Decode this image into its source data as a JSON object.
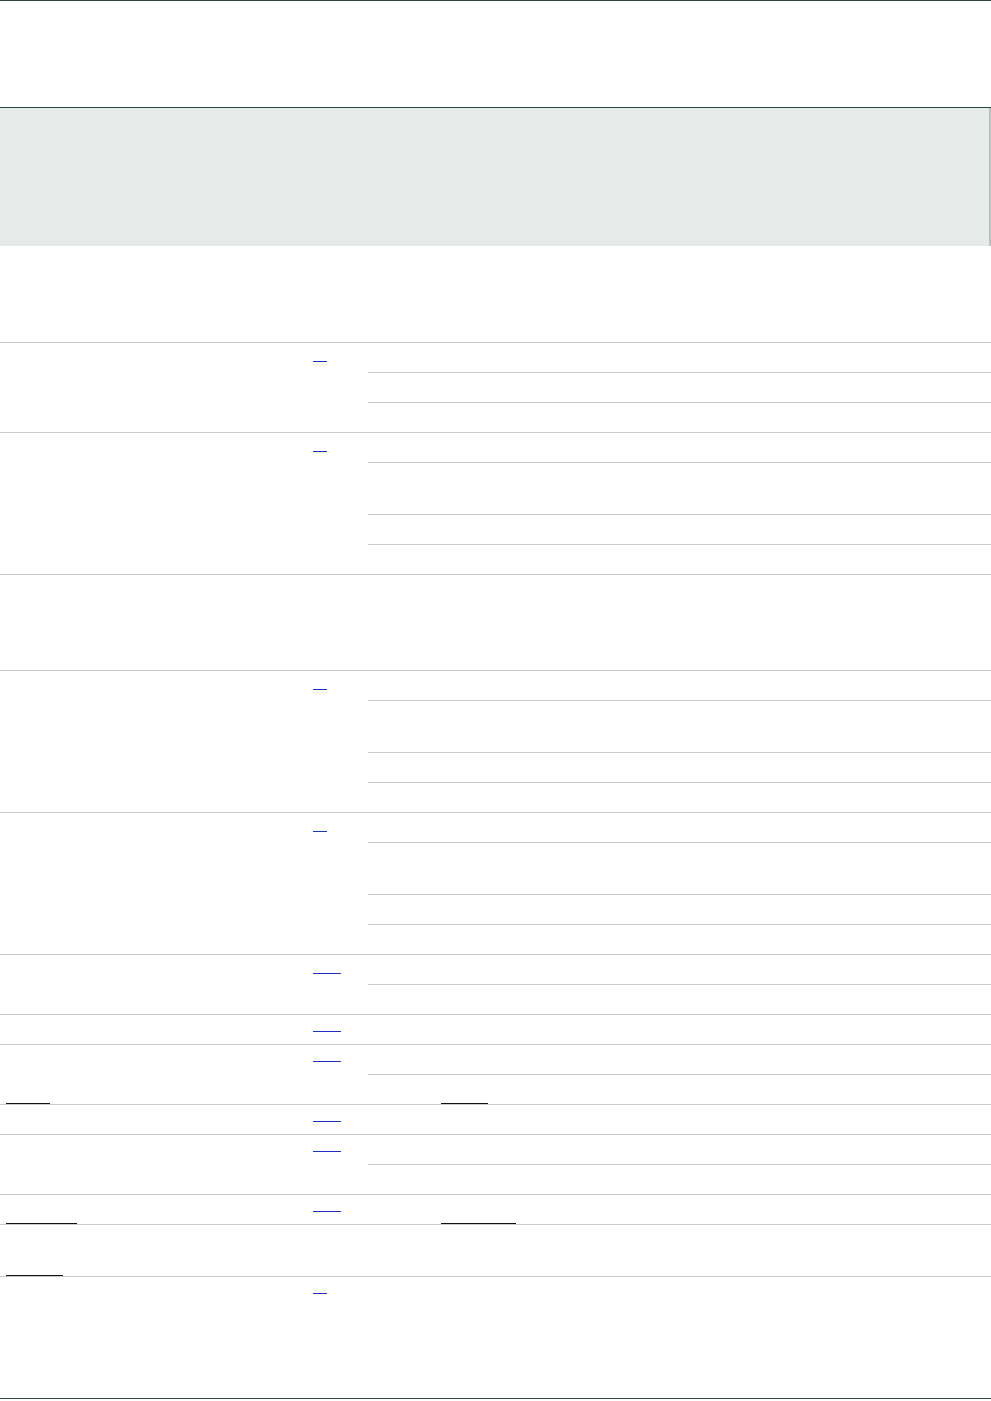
{
  "page": {
    "title": "",
    "header_band_text": "",
    "colors": {
      "frame_line": "#2e4a40",
      "band_fill": "#e6ebea",
      "row_rule": "#c4ccca",
      "link_stub": "#1f2fc4",
      "underline": "#111111"
    }
  },
  "table": {
    "groups": [
      {
        "has_link": true,
        "link_style": "short",
        "sub_rows": 3
      },
      {
        "has_link": true,
        "link_style": "short",
        "sub_rows": 4
      },
      {
        "has_link": false,
        "link_style": "",
        "sub_rows": 1
      },
      {
        "has_link": true,
        "link_style": "short",
        "sub_rows": 4
      },
      {
        "has_link": true,
        "link_style": "short",
        "sub_rows": 4
      },
      {
        "has_link": true,
        "link_style": "wide",
        "sub_rows": 2
      },
      {
        "has_link": true,
        "link_style": "wide",
        "sub_rows": 1
      },
      {
        "has_link": true,
        "link_style": "wide",
        "sub_rows": 2
      },
      {
        "has_link": true,
        "link_style": "wide",
        "sub_rows": 1
      },
      {
        "has_link": true,
        "link_style": "wide",
        "sub_rows": 2
      },
      {
        "has_link": true,
        "link_style": "wide",
        "sub_rows": 1
      },
      {
        "has_link": false,
        "link_style": "",
        "sub_rows": 1
      },
      {
        "has_link": true,
        "link_style": "short",
        "sub_rows": 1
      }
    ]
  }
}
